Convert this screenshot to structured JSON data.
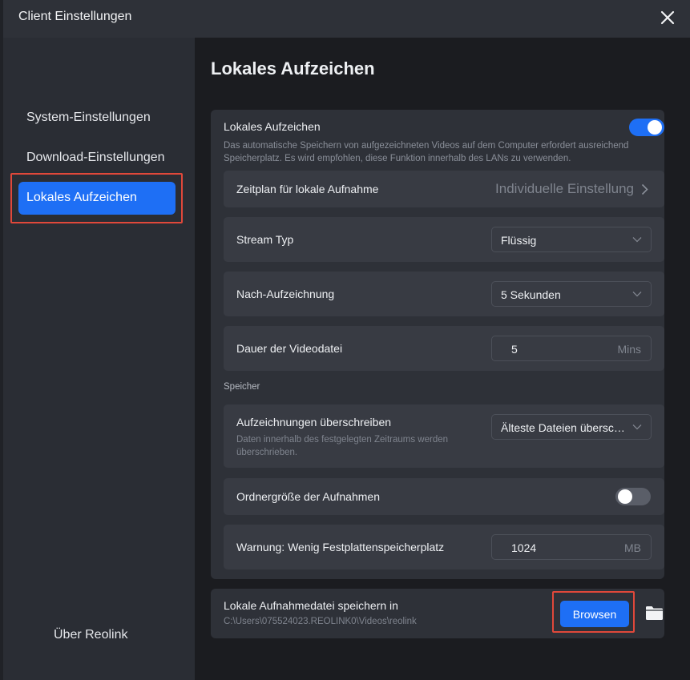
{
  "window": {
    "title": "Client Einstellungen"
  },
  "sidebar": {
    "items": [
      {
        "label": "System-Einstellungen"
      },
      {
        "label": "Download-Einstellungen"
      },
      {
        "label": "Lokales Aufzeichen",
        "active": true
      }
    ],
    "footer_label": "Über Reolink"
  },
  "main": {
    "title": "Lokales Aufzeichen",
    "recording": {
      "title": "Lokales Aufzeichen",
      "enabled": true,
      "description": "Das automatische Speichern von aufgezeichneten Videos auf dem Computer erfordert ausreichend Speicherplatz. Es wird empfohlen, diese Funktion innerhalb des LANs zu verwenden."
    },
    "schedule": {
      "label": "Zeitplan für lokale Aufnahme",
      "value": "Individuelle Einstellung"
    },
    "stream_type": {
      "label": "Stream Typ",
      "value": "Flüssig"
    },
    "post_record": {
      "label": "Nach-Aufzeichnung",
      "value": "5 Sekunden"
    },
    "file_duration": {
      "label": "Dauer der Videodatei",
      "value": "5",
      "unit": "Mins"
    },
    "storage_section": "Speicher",
    "overwrite": {
      "label": "Aufzeichnungen überschreiben",
      "description": "Daten innerhalb des festgelegten Zeitraums werden überschrieben.",
      "value": "Älteste Dateien überschreiben"
    },
    "folder_size": {
      "label": "Ordnergröße der Aufnahmen",
      "enabled": false
    },
    "low_disk_warning": {
      "label": "Warnung: Wenig Festplattenspeicherplatz",
      "value": "1024",
      "unit": "MB"
    },
    "save_location": {
      "label": "Lokale Aufnahmedatei speichern in",
      "path": "C:\\Users\\075524023.REOLINK0\\Videos\\reolink",
      "browse_label": "Browsen"
    }
  },
  "colors": {
    "accent": "#1e6ff5",
    "highlight_frame": "#e0483a"
  }
}
